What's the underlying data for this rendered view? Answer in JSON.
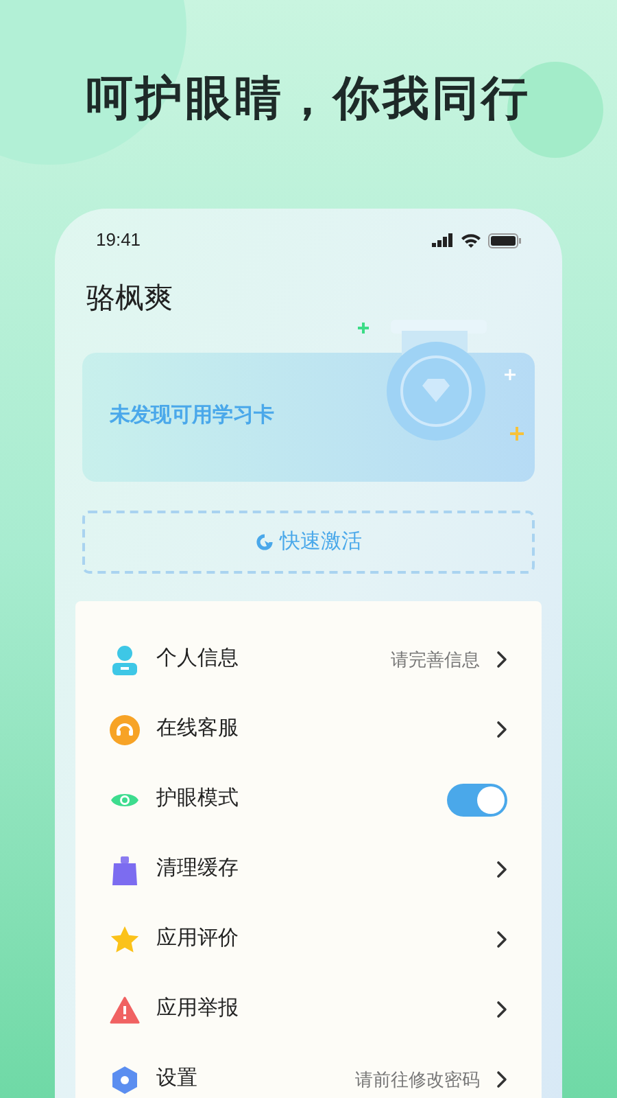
{
  "headline": "呵护眼睛，你我同行",
  "status_bar": {
    "time": "19:41"
  },
  "user": {
    "name": "骆枫爽"
  },
  "study_card": {
    "message": "未发现可用学习卡"
  },
  "activate_button": {
    "label": "快速激活"
  },
  "menu": [
    {
      "kind": "link",
      "label": "个人信息",
      "hint": "请完善信息"
    },
    {
      "kind": "link",
      "label": "在线客服"
    },
    {
      "kind": "toggle",
      "label": "护眼模式",
      "on": true
    },
    {
      "kind": "link",
      "label": "清理缓存"
    },
    {
      "kind": "link",
      "label": "应用评价"
    },
    {
      "kind": "link",
      "label": "应用举报"
    },
    {
      "kind": "link",
      "label": "设置",
      "hint": "请前往修改密码"
    }
  ]
}
